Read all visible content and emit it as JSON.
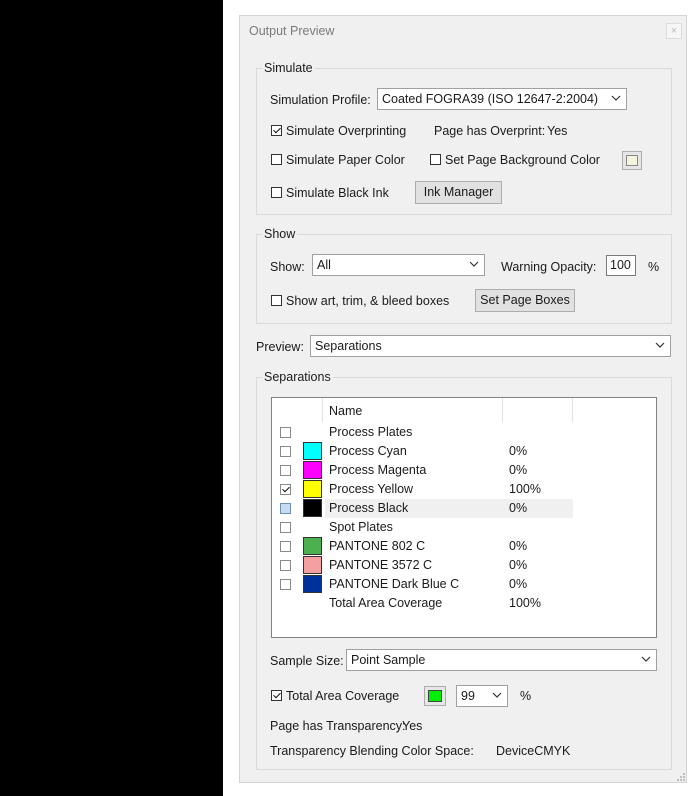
{
  "window": {
    "title": "Output Preview",
    "close_label": "×"
  },
  "simulate": {
    "legend": "Simulate",
    "profile_label": "Simulation Profile:",
    "profile_value": "Coated FOGRA39 (ISO 12647-2:2004)",
    "overprinting_label": "Simulate Overprinting",
    "overprinting_checked": true,
    "page_overprint_label": "Page has Overprint:",
    "page_overprint_value": "Yes",
    "paper_color_label": "Simulate Paper Color",
    "bg_color_label": "Set Page Background Color",
    "bg_swatch_color": "#f4f3dc",
    "black_ink_label": "Simulate Black Ink",
    "ink_manager_label": "Ink Manager"
  },
  "show": {
    "legend": "Show",
    "show_label": "Show:",
    "show_value": "All",
    "warning_label": "Warning Opacity:",
    "warning_value": "100",
    "percent": "%",
    "boxes_label": "Show art, trim, & bleed boxes",
    "set_boxes_label": "Set Page Boxes"
  },
  "preview": {
    "label": "Preview:",
    "value": "Separations"
  },
  "separations": {
    "legend": "Separations",
    "header_name": "Name",
    "rows": [
      {
        "name": "Process Plates",
        "pct": "",
        "color": "",
        "checked": false,
        "state": ""
      },
      {
        "name": "Process Cyan",
        "pct": "0%",
        "color": "#00ffff",
        "checked": false,
        "state": ""
      },
      {
        "name": "Process Magenta",
        "pct": "0%",
        "color": "#ff00ff",
        "checked": false,
        "state": ""
      },
      {
        "name": "Process Yellow",
        "pct": "100%",
        "color": "#ffff00",
        "checked": true,
        "state": ""
      },
      {
        "name": "Process Black",
        "pct": "0%",
        "color": "#000000",
        "checked": false,
        "state": "selected"
      },
      {
        "name": "Spot Plates",
        "pct": "",
        "color": "",
        "checked": false,
        "state": ""
      },
      {
        "name": "PANTONE 802 C",
        "pct": "0%",
        "color": "#4caf50",
        "checked": false,
        "state": ""
      },
      {
        "name": "PANTONE 3572 C",
        "pct": "0%",
        "color": "#f4a0a0",
        "checked": false,
        "state": ""
      },
      {
        "name": "PANTONE Dark Blue C",
        "pct": "0%",
        "color": "#00309a",
        "checked": false,
        "state": ""
      },
      {
        "name": "Total Area Coverage",
        "pct": "100%",
        "color": "",
        "checked": false,
        "state": "nocheck"
      }
    ],
    "sample_label": "Sample Size:",
    "sample_value": "Point Sample",
    "tac_label": "Total Area Coverage",
    "tac_checked": true,
    "tac_swatch_color": "#00ee00",
    "tac_value": "99",
    "tac_percent": "%",
    "transparency_label": "Page has Transparency:",
    "transparency_value": "Yes",
    "blend_label": "Transparency Blending Color Space:",
    "blend_value": "DeviceCMYK"
  }
}
